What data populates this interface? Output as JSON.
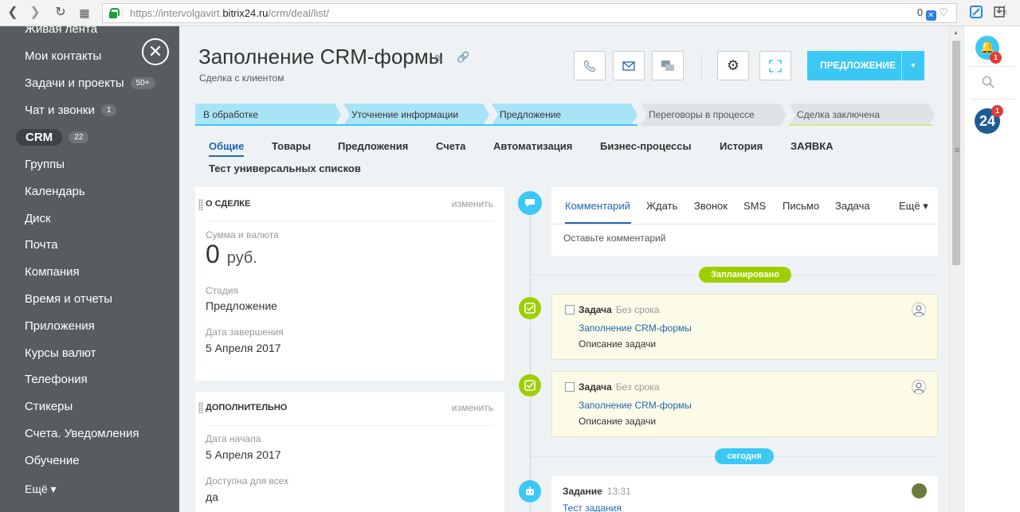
{
  "browser": {
    "url_domain_prefix": "https://intervolgavirt.",
    "url_domain": "bitrix24.ru",
    "url_path": "/crm/deal/list/",
    "extension_count": "0"
  },
  "menu": {
    "items": [
      {
        "label": "Живая лента"
      },
      {
        "label": "Мои контакты"
      },
      {
        "label": "Задачи и проекты",
        "badge": "50+"
      },
      {
        "label": "Чат и звонки",
        "badge": "1"
      },
      {
        "label": "CRM",
        "badge": "22"
      },
      {
        "label": "Группы"
      },
      {
        "label": "Календарь"
      },
      {
        "label": "Диск"
      },
      {
        "label": "Почта"
      },
      {
        "label": "Компания"
      },
      {
        "label": "Время и отчеты"
      },
      {
        "label": "Приложения"
      },
      {
        "label": "Курсы валют"
      },
      {
        "label": "Телефония"
      },
      {
        "label": "Стикеры"
      },
      {
        "label": "Счета. Уведомления"
      },
      {
        "label": "Обучение"
      },
      {
        "label": "Ещё ▾"
      }
    ]
  },
  "deal": {
    "title": "Заполнение CRM-формы",
    "subtitle": "Сделка с клиентом",
    "offer_button": "ПРЕДЛОЖЕНИЕ"
  },
  "stages": [
    {
      "label": "В обработке",
      "state": "done"
    },
    {
      "label": "Уточнение информации",
      "state": "done"
    },
    {
      "label": "Предложение",
      "state": "current"
    },
    {
      "label": "Переговоры в процессе",
      "state": "pending"
    },
    {
      "label": "Сделка заключена",
      "state": "pending"
    }
  ],
  "tabs": [
    {
      "label": "Общие"
    },
    {
      "label": "Товары"
    },
    {
      "label": "Предложения"
    },
    {
      "label": "Счета"
    },
    {
      "label": "Автоматизация"
    },
    {
      "label": "Бизнес-процессы"
    },
    {
      "label": "История"
    },
    {
      "label": "ЗАЯВКА"
    },
    {
      "label": "Тест универсальных списков"
    }
  ],
  "about": {
    "header": "О СДЕЛКЕ",
    "edit": "изменить",
    "sum_label": "Сумма и валюта",
    "sum_value": "0",
    "currency": "руб.",
    "stage_label": "Стадия",
    "stage_value": "Предложение",
    "close_label": "Дата завершения",
    "close_value": "5 Апреля 2017"
  },
  "extra": {
    "header": "ДОПОЛНИТЕЛЬНО",
    "edit": "изменить",
    "start_label": "Дата начала",
    "start_value": "5 Апреля 2017",
    "access_label": "Доступна для всех",
    "access_value": "да"
  },
  "activity": {
    "tabs": [
      {
        "label": "Комментарий"
      },
      {
        "label": "Ждать"
      },
      {
        "label": "Звонок"
      },
      {
        "label": "SMS"
      },
      {
        "label": "Письмо"
      },
      {
        "label": "Задача"
      },
      {
        "label": "Ещё ▾"
      }
    ],
    "placeholder": "Оставьте комментарий",
    "planned": "Запланировано",
    "today": "сегодня",
    "tasks": [
      {
        "type": "Задача",
        "deadline": "Без срока",
        "link": "Заполнение CRM-формы",
        "desc": "Описание задачи"
      },
      {
        "type": "Задача",
        "deadline": "Без срока",
        "link": "Заполнение CRM-формы",
        "desc": "Описание задачи"
      }
    ],
    "history": {
      "type": "Задание",
      "time": "13:31",
      "link": "Тест задания"
    }
  },
  "rightbar": {
    "bell_badge": "1",
    "app_label": "24",
    "app_badge": "1"
  },
  "colors": {
    "accent": "#3bc8f5",
    "link": "#2067b0",
    "stage_done": "#a9e4f6",
    "planned_pill": "#9dcf00",
    "menu_bg": "#585c5e"
  }
}
